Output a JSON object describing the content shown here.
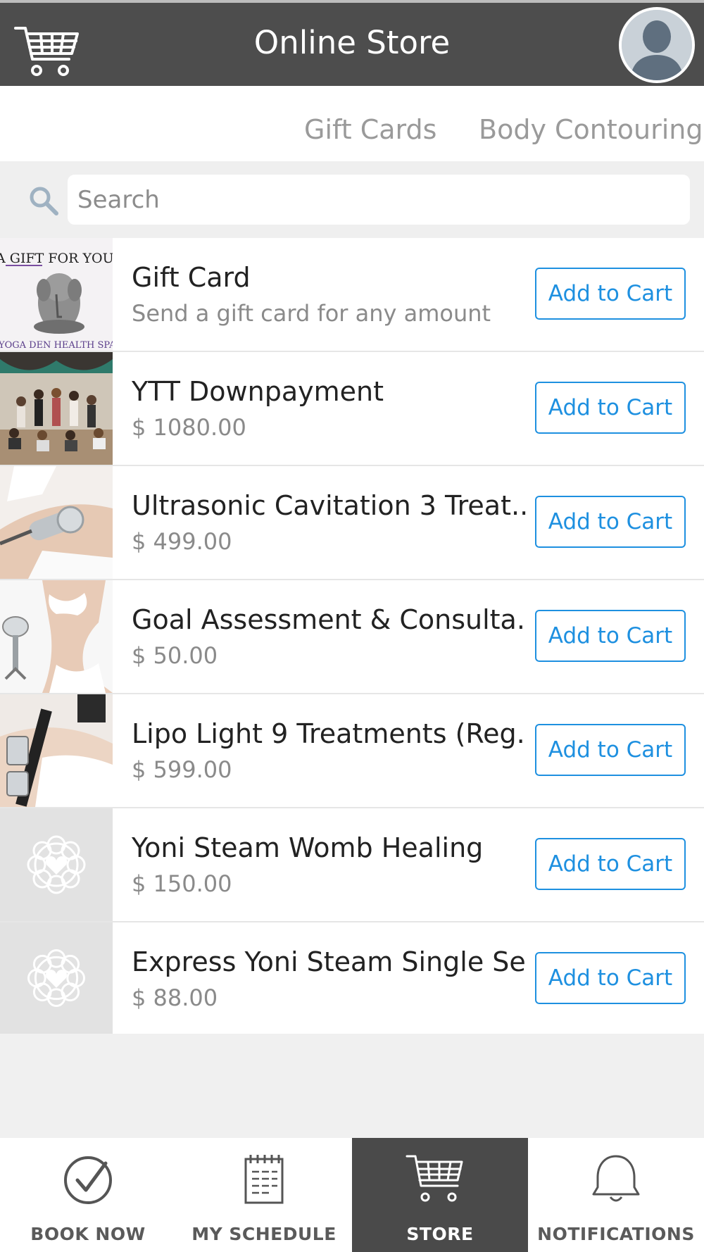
{
  "header": {
    "title": "Online Store"
  },
  "tabs": [
    {
      "label": "Gift Cards"
    },
    {
      "label": "Body Contouring"
    }
  ],
  "search": {
    "placeholder": "Search",
    "value": ""
  },
  "items": [
    {
      "name": "Gift Card",
      "subtitle": "Send a gift card for any amount",
      "button": "Add to Cart",
      "thumb_text": [
        "A GIFT FOR YOU",
        "YOGA DEN HEALTH SPA"
      ]
    },
    {
      "name": "YTT Downpayment",
      "subtitle": "$ 1080.00",
      "button": "Add to Cart"
    },
    {
      "name": "Ultrasonic Cavitation 3 Treat...",
      "subtitle": "$ 499.00",
      "button": "Add to Cart"
    },
    {
      "name": "Goal Assessment & Consulta...",
      "subtitle": "$ 50.00",
      "button": "Add to Cart"
    },
    {
      "name": "Lipo Light 9 Treatments (Reg...",
      "subtitle": "$ 599.00",
      "button": "Add to Cart"
    },
    {
      "name": "Yoni Steam Womb Healing",
      "subtitle": "$ 150.00",
      "button": "Add to Cart"
    },
    {
      "name": "Express Yoni Steam Single Se...",
      "subtitle": "$ 88.00",
      "button": "Add to Cart"
    }
  ],
  "bottom_nav": [
    {
      "label": "BOOK NOW",
      "icon": "check-circle-icon",
      "active": false
    },
    {
      "label": "MY SCHEDULE",
      "icon": "calendar-icon",
      "active": false
    },
    {
      "label": "STORE",
      "icon": "cart-icon",
      "active": true
    },
    {
      "label": "NOTIFICATIONS",
      "icon": "bell-icon",
      "active": false
    }
  ],
  "colors": {
    "header_bg": "#4d4d4d",
    "accent": "#1e90e0",
    "active_nav_bg": "#4a4a4a"
  }
}
